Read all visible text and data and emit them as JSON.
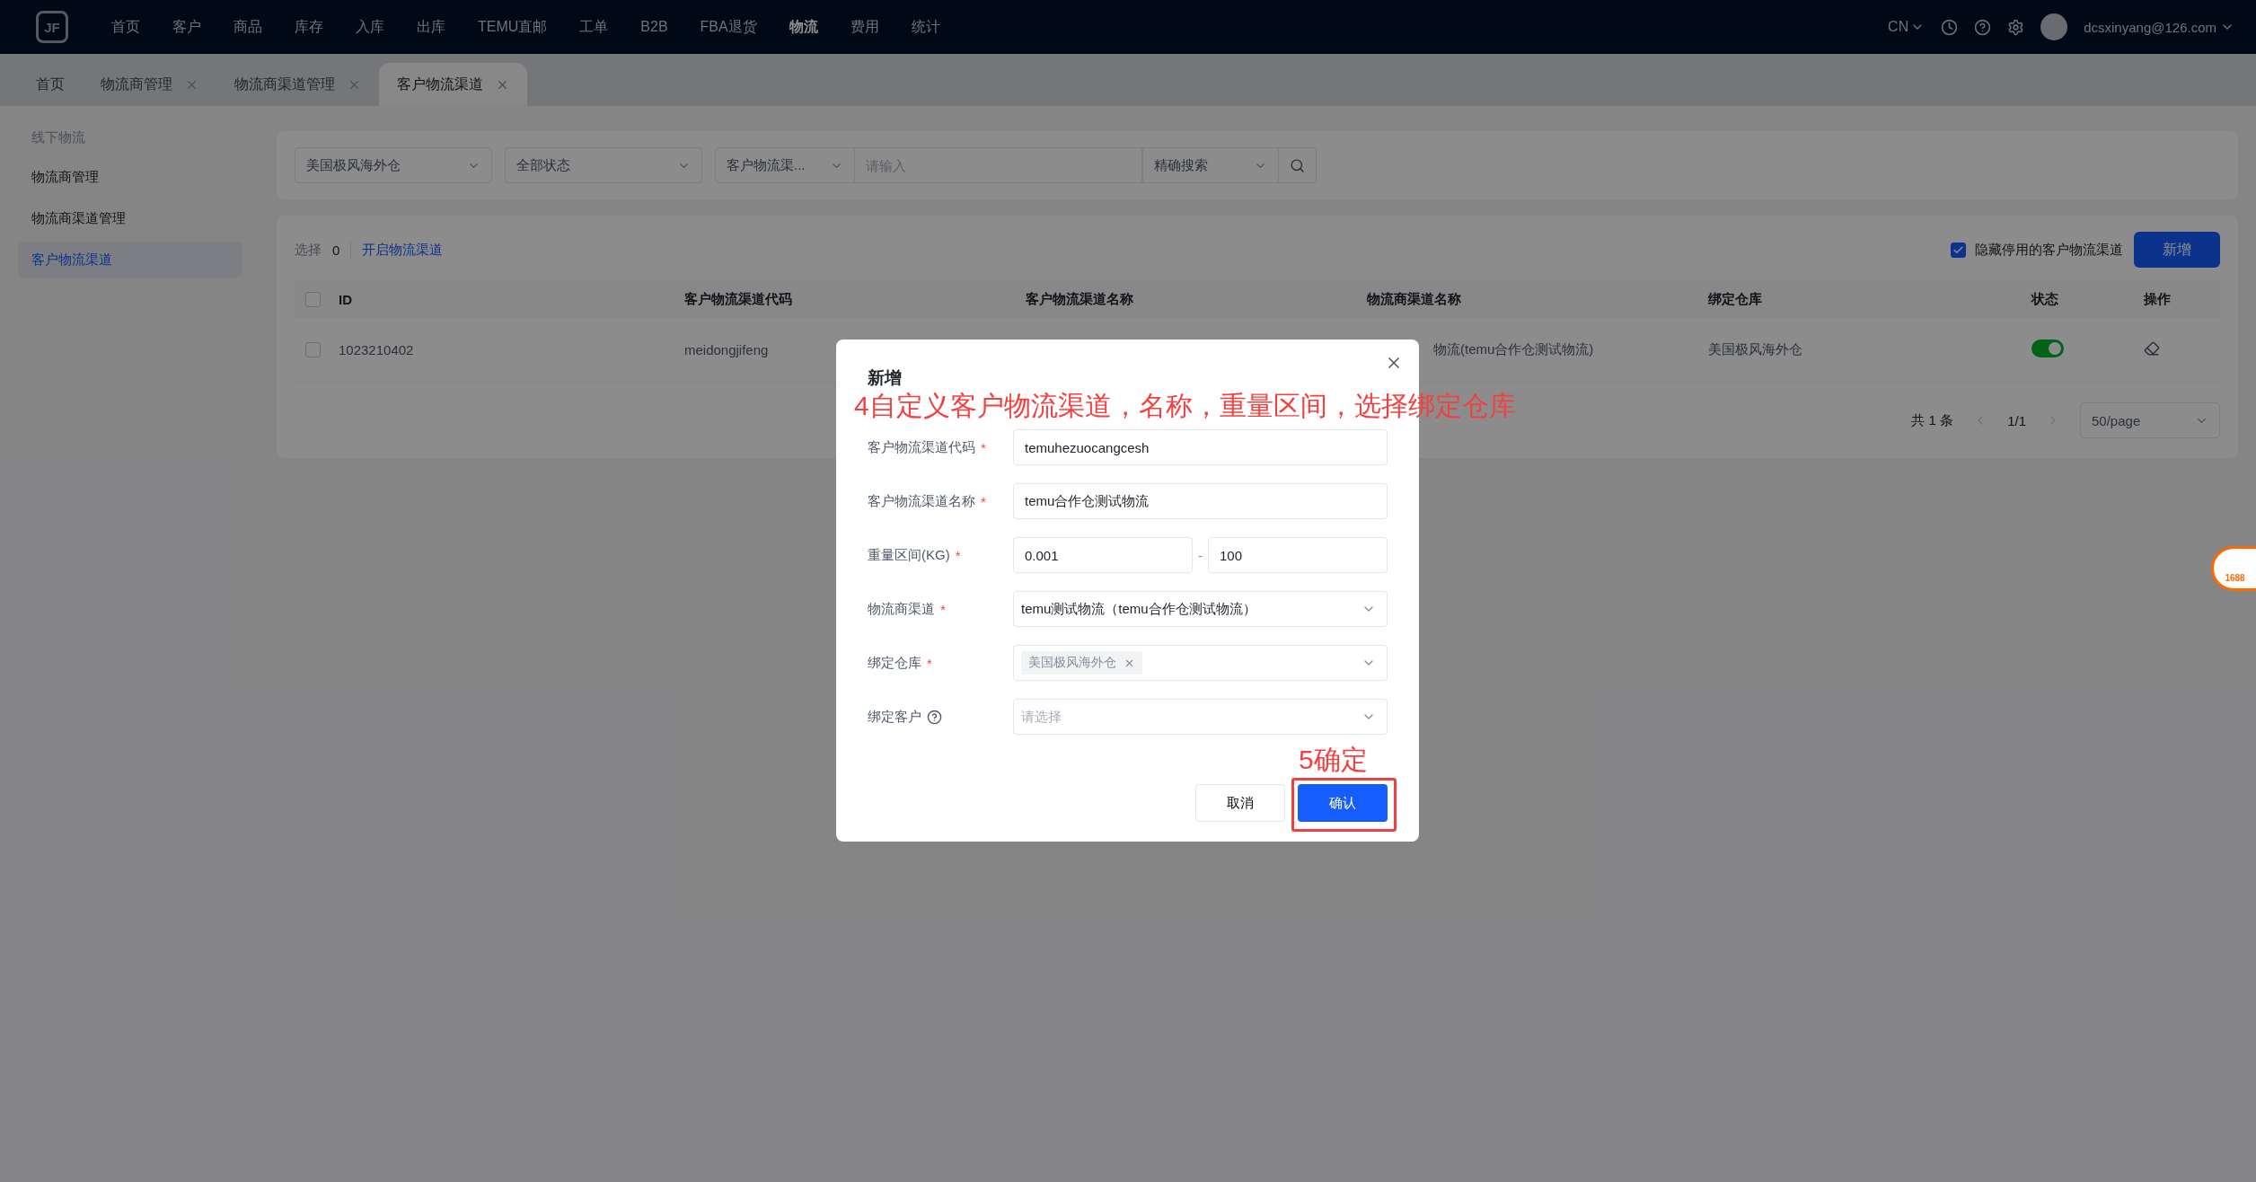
{
  "topbar": {
    "logo_text": "JF",
    "nav": [
      {
        "label": "首页",
        "selected": false
      },
      {
        "label": "客户",
        "selected": false
      },
      {
        "label": "商品",
        "selected": false
      },
      {
        "label": "库存",
        "selected": false
      },
      {
        "label": "入库",
        "selected": false
      },
      {
        "label": "出库",
        "selected": false
      },
      {
        "label": "TEMU直邮",
        "selected": false
      },
      {
        "label": "工单",
        "selected": false
      },
      {
        "label": "B2B",
        "selected": false
      },
      {
        "label": "FBA退货",
        "selected": false
      },
      {
        "label": "物流",
        "selected": true
      },
      {
        "label": "费用",
        "selected": false
      },
      {
        "label": "统计",
        "selected": false
      }
    ],
    "language": "CN",
    "user": "dcsxinyang@126.com"
  },
  "tabs": [
    {
      "label": "首页",
      "selected": false,
      "closable": false
    },
    {
      "label": "物流商管理",
      "selected": false,
      "closable": true
    },
    {
      "label": "物流商渠道管理",
      "selected": false,
      "closable": true
    },
    {
      "label": "客户物流渠道",
      "selected": true,
      "closable": true
    }
  ],
  "sidebar": {
    "group": "线下物流",
    "items": [
      {
        "label": "物流商管理",
        "selected": false
      },
      {
        "label": "物流商渠道管理",
        "selected": false
      },
      {
        "label": "客户物流渠道",
        "selected": true
      }
    ]
  },
  "filters": {
    "warehouse": "美国极风海外仓",
    "status": "全部状态",
    "field": "客户物流渠...",
    "placeholder": "请输入",
    "mode": "精确搜索"
  },
  "toolbar": {
    "selected_label": "选择",
    "selected_count": "0",
    "action_link": "开启物流渠道",
    "hide_disabled": {
      "label": "隐藏停用的客户物流渠道",
      "checked": true
    },
    "add_button": "新增"
  },
  "table": {
    "select_all_checked": false,
    "columns": [
      "ID",
      "客户物流渠道代码",
      "客户物流渠道名称",
      "物流商渠道名称",
      "绑定仓库",
      "状态",
      "操作"
    ],
    "rows": [
      {
        "checked": false,
        "id": "1023210402",
        "code": "meidongjifeng",
        "carrier_channel": "物流(temu合作仓测试物流)",
        "warehouse": "美国极风海外仓",
        "on": true
      }
    ]
  },
  "pagination": {
    "total": "共 1 条",
    "page": "1/1",
    "page_size": "50/page"
  },
  "side_badge": "1688",
  "dialog": {
    "title": "新增",
    "fields": [
      {
        "kind": "input",
        "label": "客户物流渠道代码",
        "required_mark": "*",
        "value": "temuhezuocangcesh"
      },
      {
        "kind": "input",
        "label": "客户物流渠道名称",
        "required_mark": "*",
        "value": "temu合作仓测试物流"
      },
      {
        "kind": "range",
        "label": "重量区间(KG)",
        "required_mark": "*",
        "from": "0.001",
        "separator": "-",
        "to": "100"
      },
      {
        "kind": "select",
        "label": "物流商渠道",
        "required_mark": "*",
        "value": "temu测试物流（temu合作仓测试物流）"
      },
      {
        "kind": "tags",
        "label": "绑定仓库",
        "required_mark": "*",
        "tags": [
          "美国极风海外仓"
        ]
      },
      {
        "kind": "select",
        "label": "绑定客户",
        "help": true,
        "placeholder": "请选择"
      }
    ],
    "cancel": "取消",
    "confirm": "确认"
  },
  "annotations": [
    {
      "kind": "caption",
      "text": "4自定义客户物流渠道，名称，重量区间，选择绑定仓库"
    },
    {
      "kind": "boxed",
      "text": "5确定"
    }
  ]
}
